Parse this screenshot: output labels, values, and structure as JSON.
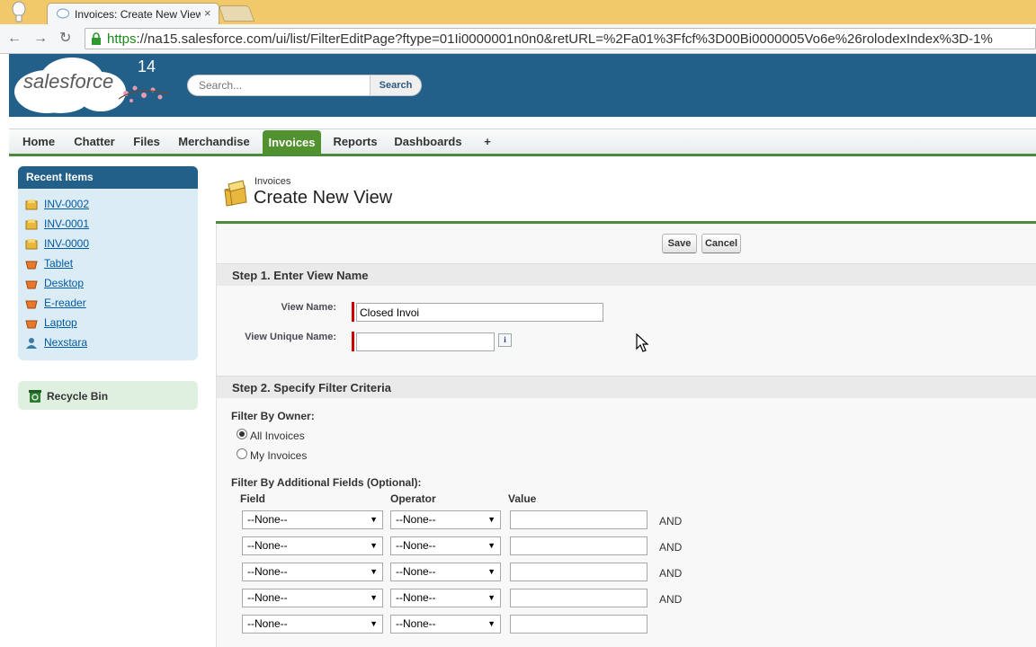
{
  "browser": {
    "tab_title": "Invoices: Create New View",
    "url_scheme": "https",
    "url_rest": "://na15.salesforce.com/ui/list/FilterEditPage?ftype=01Ii0000001n0n0&retURL=%2Fa01%3Ffcf%3D00Bi0000005Vo6e%26rolodexIndex%3D-1%"
  },
  "header": {
    "logo_text": "salesforce",
    "version": "14",
    "search_placeholder": "Search...",
    "search_button": "Search"
  },
  "nav_tabs": [
    {
      "label": "Home"
    },
    {
      "label": "Chatter"
    },
    {
      "label": "Files"
    },
    {
      "label": "Merchandise"
    },
    {
      "label": "Invoices",
      "active": true
    },
    {
      "label": "Reports"
    },
    {
      "label": "Dashboards"
    },
    {
      "label": "+"
    }
  ],
  "sidebar": {
    "recent_title": "Recent Items",
    "recent_items": [
      {
        "label": "INV-0002",
        "icon": "invoice-icon"
      },
      {
        "label": "INV-0001",
        "icon": "invoice-icon"
      },
      {
        "label": "INV-0000",
        "icon": "invoice-icon"
      },
      {
        "label": "Tablet",
        "icon": "merchandise-icon"
      },
      {
        "label": "Desktop",
        "icon": "merchandise-icon"
      },
      {
        "label": "E-reader",
        "icon": "merchandise-icon"
      },
      {
        "label": "Laptop",
        "icon": "merchandise-icon"
      },
      {
        "label": "Nexstara",
        "icon": "user-icon"
      }
    ],
    "recycle_bin": "Recycle Bin"
  },
  "page": {
    "object_type": "Invoices",
    "title": "Create New View",
    "save_label": "Save",
    "cancel_label": "Cancel"
  },
  "step1": {
    "title": "Step 1. Enter View Name",
    "view_name_label": "View Name:",
    "view_name_value": "Closed Invoi",
    "unique_name_label": "View Unique Name:",
    "unique_name_value": "",
    "info_glyph": "i"
  },
  "step2": {
    "title": "Step 2. Specify Filter Criteria",
    "filter_owner_label": "Filter By Owner:",
    "owner_options": [
      {
        "label": "All Invoices",
        "checked": true
      },
      {
        "label": "My Invoices",
        "checked": false
      }
    ],
    "additional_label": "Filter By Additional Fields (Optional):",
    "columns": {
      "field": "Field",
      "operator": "Operator",
      "value": "Value"
    },
    "rows": [
      {
        "field": "--None--",
        "operator": "--None--",
        "value": "",
        "conj": "AND"
      },
      {
        "field": "--None--",
        "operator": "--None--",
        "value": "",
        "conj": "AND"
      },
      {
        "field": "--None--",
        "operator": "--None--",
        "value": "",
        "conj": "AND"
      },
      {
        "field": "--None--",
        "operator": "--None--",
        "value": "",
        "conj": "AND"
      },
      {
        "field": "--None--",
        "operator": "--None--",
        "value": "",
        "conj": ""
      }
    ]
  },
  "colors": {
    "header_blue": "#236089",
    "active_tab_green": "#52912f",
    "link_blue": "#015ba7",
    "required_red": "#cc0000"
  }
}
